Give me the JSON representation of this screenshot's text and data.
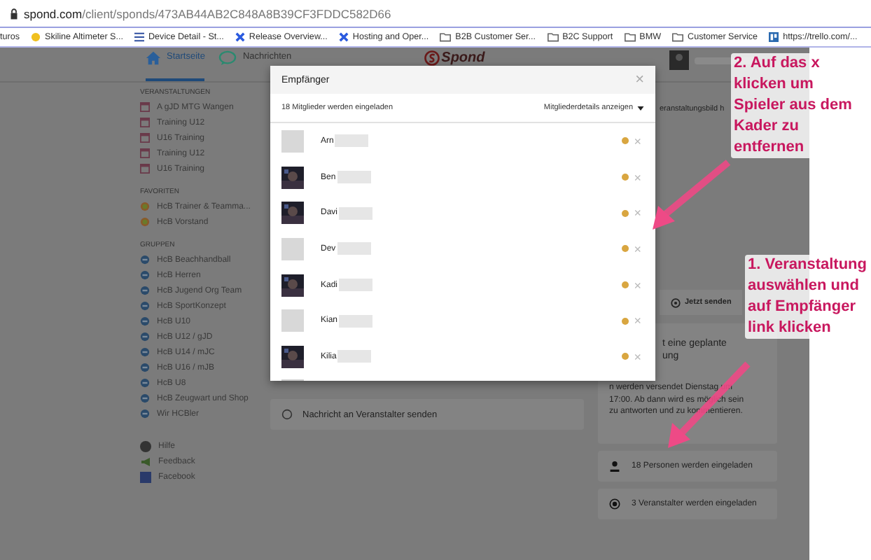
{
  "browser": {
    "url_host": "spond.com",
    "url_path": "/client/sponds/473AB44AB2C848A8B39CF3FDDC582D66",
    "bookmarks": [
      {
        "kind": "text",
        "label": "turos"
      },
      {
        "kind": "badge",
        "label": "Skiline Altimeter S..."
      },
      {
        "kind": "list",
        "label": "Device Detail - St..."
      },
      {
        "kind": "cross",
        "label": "Release Overview..."
      },
      {
        "kind": "cross",
        "label": "Hosting and Oper..."
      },
      {
        "kind": "folder",
        "label": "B2B Customer Ser..."
      },
      {
        "kind": "folder",
        "label": "B2C Support"
      },
      {
        "kind": "folder",
        "label": "BMW"
      },
      {
        "kind": "folder",
        "label": "Customer Service"
      },
      {
        "kind": "trello",
        "label": "https://trello.com/..."
      }
    ]
  },
  "nav": {
    "tabs": [
      {
        "label": "Startseite",
        "kind": "home",
        "selected": true
      },
      {
        "label": "Nachrichten",
        "kind": "chat",
        "selected": false
      }
    ],
    "logo": "Spond"
  },
  "sidebar": {
    "sections": [
      {
        "title": "VERANSTALTUNGEN",
        "items": [
          {
            "kind": "calendar",
            "label": "A gJD MTG Wangen"
          },
          {
            "kind": "calendar",
            "label": "Training U12"
          },
          {
            "kind": "calendar",
            "label": "U16 Training"
          },
          {
            "kind": "calendar",
            "label": "Training U12"
          },
          {
            "kind": "calendar",
            "label": "U16 Training"
          }
        ]
      },
      {
        "title": "FAVORITEN",
        "items": [
          {
            "kind": "favorite",
            "label": "HcB Trainer & Teamma..."
          },
          {
            "kind": "favorite",
            "label": "HcB Vorstand"
          }
        ]
      },
      {
        "title": "GRUPPEN",
        "items": [
          {
            "kind": "group",
            "label": "HcB Beachhandball"
          },
          {
            "kind": "group",
            "label": "HcB Herren"
          },
          {
            "kind": "group",
            "label": "HcB Jugend Org Team"
          },
          {
            "kind": "group",
            "label": "HcB SportKonzept"
          },
          {
            "kind": "group",
            "label": "HcB U10"
          },
          {
            "kind": "group",
            "label": "HcB U12 / gJD"
          },
          {
            "kind": "group",
            "label": "HcB U14 / mJC"
          },
          {
            "kind": "group",
            "label": "HcB U16 / mJB"
          },
          {
            "kind": "group",
            "label": "HcB U8"
          },
          {
            "kind": "group",
            "label": "HcB Zeugwart und Shop"
          },
          {
            "kind": "group",
            "label": "Wir HCBler"
          }
        ]
      }
    ],
    "footer": [
      {
        "kind": "help",
        "label": "Hilfe"
      },
      {
        "kind": "feedback",
        "label": "Feedback"
      },
      {
        "kind": "facebook",
        "label": "Facebook"
      }
    ]
  },
  "main": {
    "message_button": "Nachricht an Veranstalter senden"
  },
  "right": {
    "image_label": "eranstaltungsbild h",
    "send_button": "Jetzt senden",
    "notice": {
      "title_lines": [
        "t eine geplante",
        "ung"
      ],
      "text": "n werden versendet Dienstag um 17:00. Ab dann wird es möglich sein zu antworten und zu kommentieren."
    },
    "links": [
      {
        "kind": "person",
        "label": "18 Personen werden eingeladen"
      },
      {
        "kind": "radio",
        "label": "3 Veranstalter werden eingeladen"
      }
    ]
  },
  "modal": {
    "title": "Empfänger",
    "close": "×",
    "summary": "18 Mitglieder werden eingeladen",
    "details_menu": "Mitgliederdetails anzeigen",
    "members": [
      {
        "name": "Arn",
        "kind": "initials",
        "color": "#d9a640",
        "remove": "×"
      },
      {
        "name": "Ben",
        "color": "#d9a640",
        "remove": "×"
      },
      {
        "name": "Davi",
        "color": "#d9a640",
        "remove": "×"
      },
      {
        "name": "Dev",
        "kind": "initials",
        "color": "#d9a640",
        "remove": "×"
      },
      {
        "name": "Kadi",
        "color": "#d9a640",
        "remove": "×"
      },
      {
        "name": "Kian",
        "kind": "initials",
        "color": "#d9a640",
        "remove": "×"
      },
      {
        "name": "Kilia",
        "color": "#d9a640",
        "remove": "×"
      }
    ]
  },
  "annotations": [
    {
      "text": "2. Auf das x klicken um Spieler aus dem Kader zu entfernen"
    },
    {
      "text": "1. Veranstaltung auswählen und auf Empfänger link klicken"
    }
  ]
}
